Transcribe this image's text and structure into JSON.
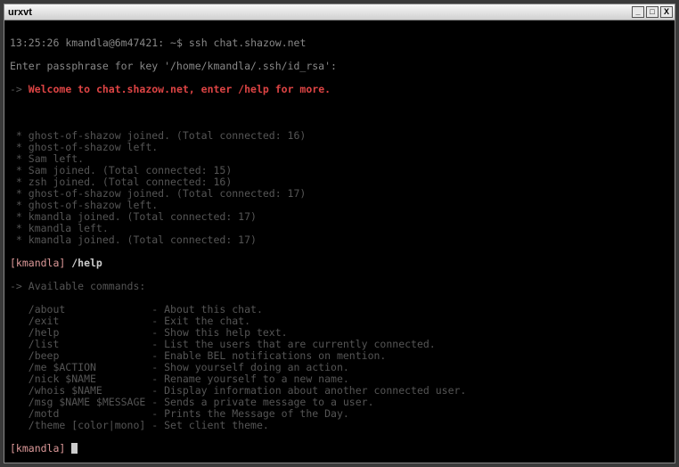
{
  "window": {
    "title": "urxvt",
    "buttons": {
      "min": "_",
      "max": "□",
      "close": "X"
    }
  },
  "prompt": {
    "time": "13:25:26",
    "userhost": "kmandla@6m47421",
    "path": "~",
    "symbol": "$",
    "command": "ssh chat.shazow.net"
  },
  "passphrase_line": "Enter passphrase for key '/home/kmandla/.ssh/id_rsa':",
  "welcome": {
    "arrow": "->",
    "text": " Welcome to chat.shazow.net, enter /help for more."
  },
  "events": [
    " * ghost-of-shazow joined. (Total connected: 16)",
    " * ghost-of-shazow left.",
    " * Sam left.",
    " * Sam joined. (Total connected: 15)",
    " * zsh joined. (Total connected: 16)",
    " * ghost-of-shazow joined. (Total connected: 17)",
    " * ghost-of-shazow left.",
    " * kmandla joined. (Total connected: 17)",
    " * kmandla left.",
    " * kmandla joined. (Total connected: 17)"
  ],
  "user_input": {
    "name": "[kmandla]",
    "cmd": " /help"
  },
  "help_header": "-> Available commands:",
  "help": [
    {
      "cmd": "   /about              ",
      "desc": "- About this chat."
    },
    {
      "cmd": "   /exit               ",
      "desc": "- Exit the chat."
    },
    {
      "cmd": "   /help               ",
      "desc": "- Show this help text."
    },
    {
      "cmd": "   /list               ",
      "desc": "- List the users that are currently connected."
    },
    {
      "cmd": "   /beep               ",
      "desc": "- Enable BEL notifications on mention."
    },
    {
      "cmd": "   /me $ACTION         ",
      "desc": "- Show yourself doing an action."
    },
    {
      "cmd": "   /nick $NAME         ",
      "desc": "- Rename yourself to a new name."
    },
    {
      "cmd": "   /whois $NAME        ",
      "desc": "- Display information about another connected user."
    },
    {
      "cmd": "   /msg $NAME $MESSAGE ",
      "desc": "- Sends a private message to a user."
    },
    {
      "cmd": "   /motd               ",
      "desc": "- Prints the Message of the Day."
    },
    {
      "cmd": "   /theme [color|mono] ",
      "desc": "- Set client theme."
    }
  ],
  "final_prompt": {
    "name": "[kmandla]",
    "space": " "
  }
}
